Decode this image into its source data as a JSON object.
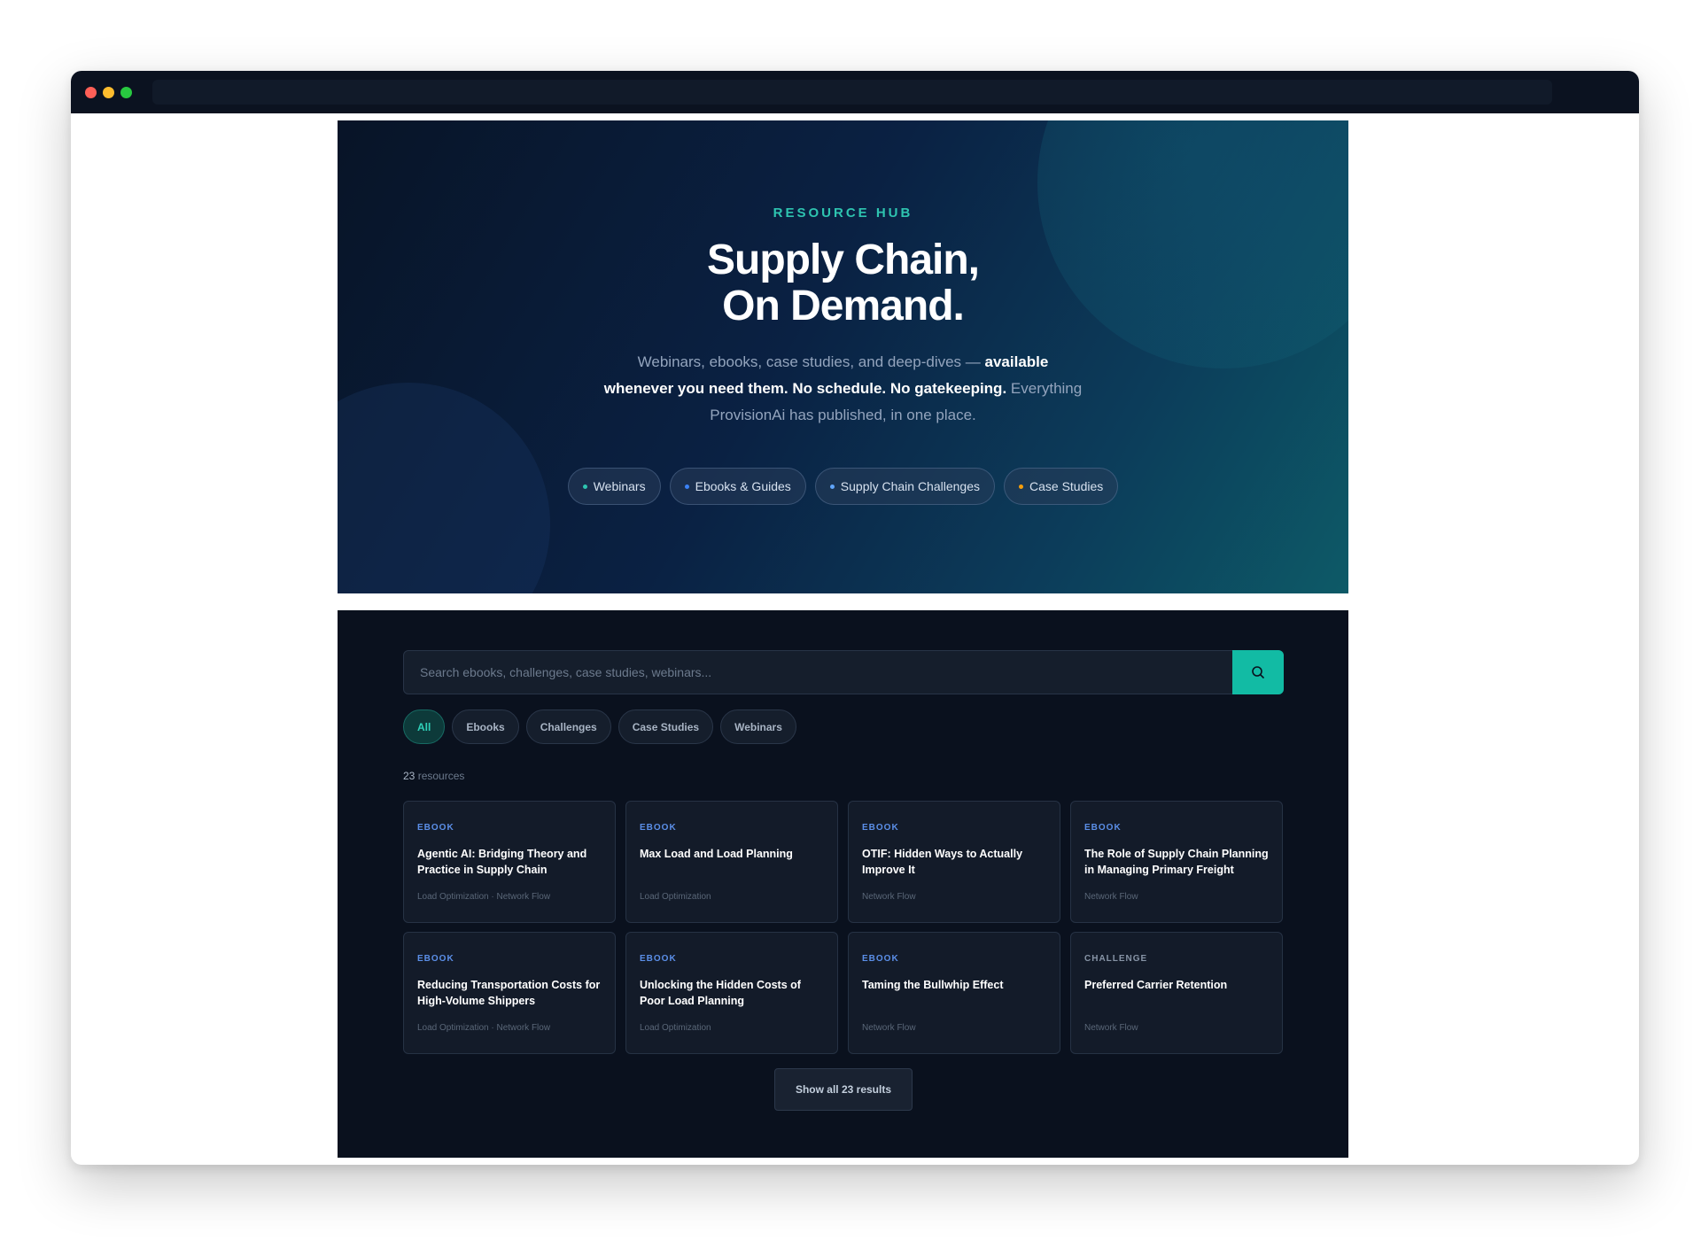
{
  "hero": {
    "eyebrow": "RESOURCE HUB",
    "title_line1": "Supply Chain,",
    "title_line2": "On Demand.",
    "sub_part1": "Webinars, ebooks, case studies, and deep-dives — ",
    "sub_em1": "available whenever you need them. No schedule. No gatekeeping.",
    "sub_part2": " Everything ProvisionAi has published, in one place.",
    "pills": [
      {
        "label": "Webinars",
        "color": "#2ec4b0"
      },
      {
        "label": "Ebooks & Guides",
        "color": "#3b82f6"
      },
      {
        "label": "Supply Chain Challenges",
        "color": "#60a5fa"
      },
      {
        "label": "Case Studies",
        "color": "#f59e0b"
      }
    ]
  },
  "search": {
    "placeholder": "Search ebooks, challenges, case studies, webinars..."
  },
  "filters": [
    "All",
    "Ebooks",
    "Challenges",
    "Case Studies",
    "Webinars"
  ],
  "results": {
    "count": "23",
    "count_label": " resources",
    "show_all": "Show all 23 results"
  },
  "cards": [
    {
      "type": "EBOOK",
      "title": "Agentic AI: Bridging Theory and Practice in Supply Chain",
      "tags": "Load Optimization · Network Flow"
    },
    {
      "type": "EBOOK",
      "title": "Max Load and Load Planning",
      "tags": "Load Optimization"
    },
    {
      "type": "EBOOK",
      "title": "OTIF: Hidden Ways to Actually Improve It",
      "tags": "Network Flow"
    },
    {
      "type": "EBOOK",
      "title": "The Role of Supply Chain Planning in Managing Primary Freight",
      "tags": "Network Flow"
    },
    {
      "type": "EBOOK",
      "title": "Reducing Transportation Costs for High-Volume Shippers",
      "tags": "Load Optimization · Network Flow"
    },
    {
      "type": "EBOOK",
      "title": "Unlocking the Hidden Costs of Poor Load Planning",
      "tags": "Load Optimization"
    },
    {
      "type": "EBOOK",
      "title": "Taming the Bullwhip Effect",
      "tags": "Network Flow"
    },
    {
      "type": "CHALLENGE",
      "title": "Preferred Carrier Retention",
      "tags": "Network Flow"
    }
  ],
  "colors": {
    "accent": "#12bba4",
    "ebook_label": "#5b8fe8"
  }
}
